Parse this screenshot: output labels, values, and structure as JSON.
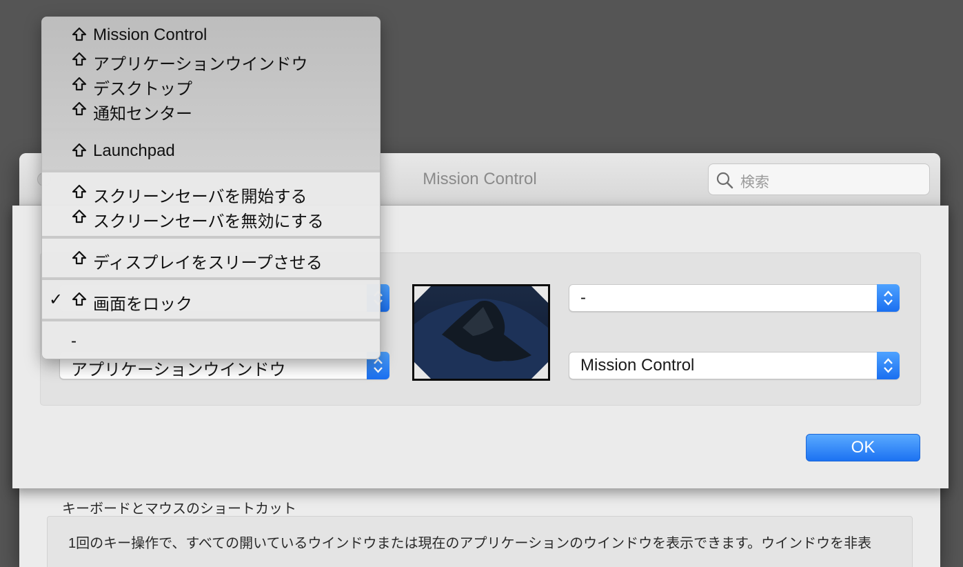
{
  "window": {
    "title": "Mission Control",
    "search_placeholder": "検索",
    "section_label": "キーボードとマウスのショートカット",
    "description": "1回のキー操作で、すべての開いているウインドウまたは現在のアプリケーションのウインドウを表示できます。ウインドウを非表"
  },
  "sheet": {
    "popups": {
      "top_left": "",
      "bottom_left": "アプリケーションウインドウ",
      "top_right": "-",
      "bottom_right": "Mission Control"
    },
    "ok_label": "OK"
  },
  "menu": {
    "items": [
      {
        "label": "Mission Control",
        "shift": true,
        "checked": false
      },
      {
        "label": "アプリケーションウインドウ",
        "shift": true,
        "checked": false
      },
      {
        "label": "デスクトップ",
        "shift": true,
        "checked": false
      },
      {
        "label": "通知センター",
        "shift": true,
        "checked": false
      },
      {
        "label": "Launchpad",
        "shift": true,
        "checked": false
      },
      {
        "label": "スクリーンセーバを開始する",
        "shift": true,
        "checked": false
      },
      {
        "label": "スクリーンセーバを無効にする",
        "shift": true,
        "checked": false
      },
      {
        "label": "ディスプレイをスリープさせる",
        "shift": true,
        "checked": false
      },
      {
        "label": "画面をロック",
        "shift": true,
        "checked": true
      },
      {
        "label": "-",
        "shift": false,
        "checked": false
      }
    ],
    "check_glyph": "✓"
  },
  "colors": {
    "accent": "#1c72f2",
    "desktop_background": "#555555"
  }
}
